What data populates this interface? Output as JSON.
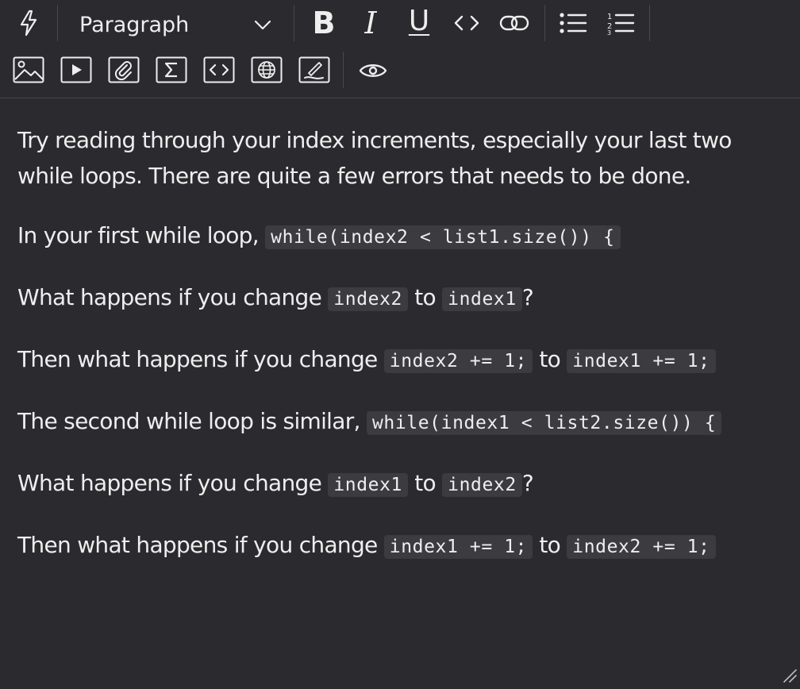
{
  "toolbar": {
    "row1": {
      "format_select": {
        "selected": "Paragraph"
      },
      "bold_label": "B",
      "italic_label": "I",
      "underline_label": "U"
    },
    "icons": {
      "ai_assist": "lightning-icon",
      "code_inline": "code-icon",
      "link": "link-icon",
      "bullet_list": "bullet-list-icon",
      "numbered_list": "numbered-list-icon",
      "image": "image-icon",
      "video": "play-icon",
      "attachment": "paperclip-icon",
      "equation": "sigma-icon",
      "embed": "code-block-icon",
      "web": "globe-icon",
      "draw": "pen-icon",
      "preview": "eye-icon"
    }
  },
  "content": {
    "p1": "Try reading through your index increments, especially your last two while loops. There are quite a few errors that needs to be done.",
    "p2": {
      "text": "In your first while loop, ",
      "code": "while(index2 < list1.size()) {"
    },
    "p3": {
      "pre": "What happens if you change ",
      "code1": "index2",
      "mid": " to ",
      "code2": "index1",
      "post": "?"
    },
    "p4": {
      "pre": "Then what happens if you change ",
      "code1": "index2 += 1;",
      "mid": " to ",
      "code2": "index1 += 1;"
    },
    "p5": {
      "text": "The second while loop is similar, ",
      "code": "while(index1 < list2.size()) {"
    },
    "p6": {
      "pre": "What happens if you change ",
      "code1": "index1",
      "mid": " to ",
      "code2": "index2",
      "post": "?"
    },
    "p7": {
      "pre": "Then what happens if you change ",
      "code1": "index1 += 1;",
      "mid": " to ",
      "code2": "index2 += 1;"
    }
  },
  "colors": {
    "background": "#2b2a2e",
    "text": "#eeeeee",
    "code_background": "#3c3b40",
    "separator": "#48474c"
  }
}
